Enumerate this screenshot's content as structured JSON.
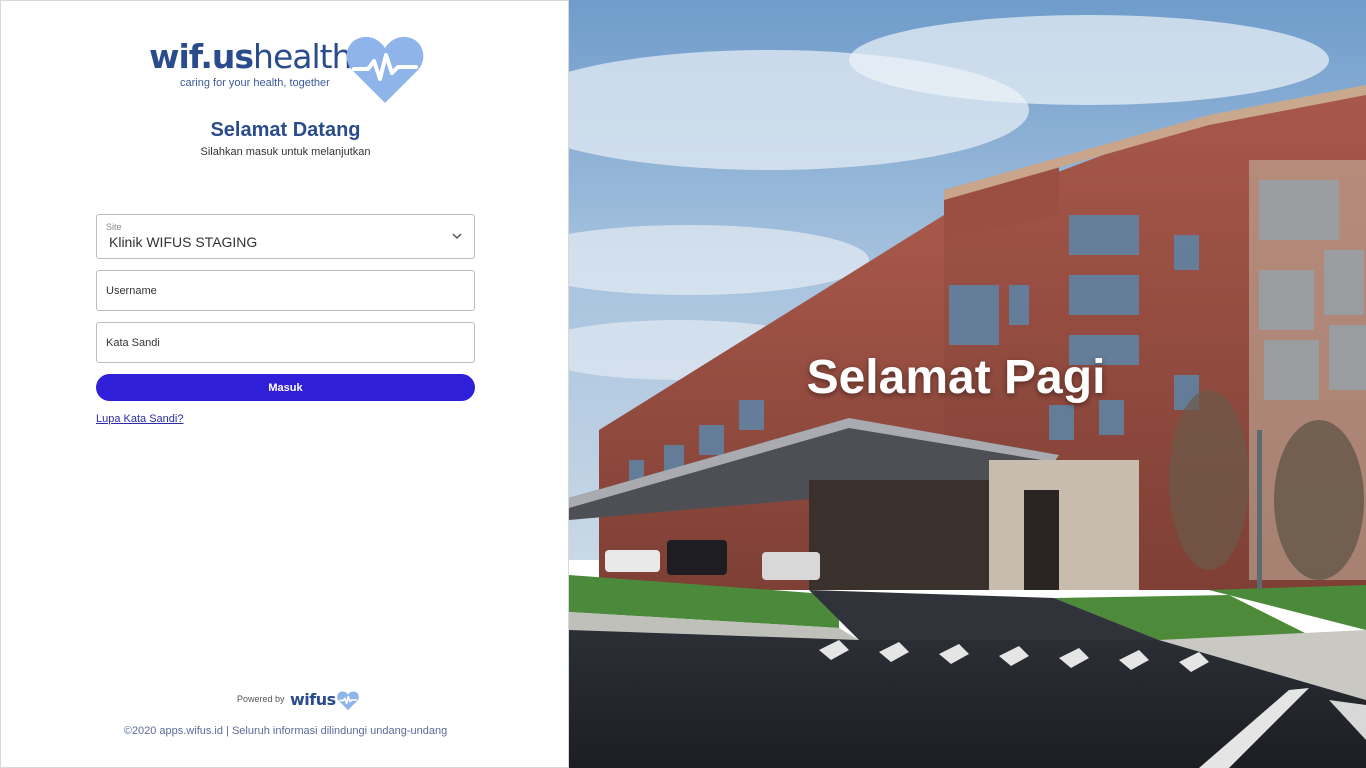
{
  "brand": {
    "name_bold": "wif.us",
    "name_light": "health",
    "tagline": "caring for your health, together"
  },
  "welcome": {
    "title": "Selamat Datang",
    "subtitle": "Silahkan masuk untuk melanjutkan"
  },
  "form": {
    "site_label": "Site",
    "site_value": "Klinik WIFUS STAGING",
    "username_placeholder": "Username",
    "password_placeholder": "Kata Sandi",
    "login_label": "Masuk",
    "forgot_label": "Lupa Kata Sandi?"
  },
  "footer": {
    "powered_by": "Powered by",
    "powered_brand": "wifus",
    "copyright": "©2020 apps.wifus.id | Seluruh informasi dilindungi undang-undang"
  },
  "hero": {
    "greeting": "Selamat Pagi"
  },
  "colors": {
    "brand_blue": "#2b4c8c",
    "heart_blue": "#8fb4ea",
    "button": "#2f1fd9"
  },
  "icons": {
    "heart": "heart-pulse-icon",
    "dropdown": "chevron-down-icon"
  }
}
